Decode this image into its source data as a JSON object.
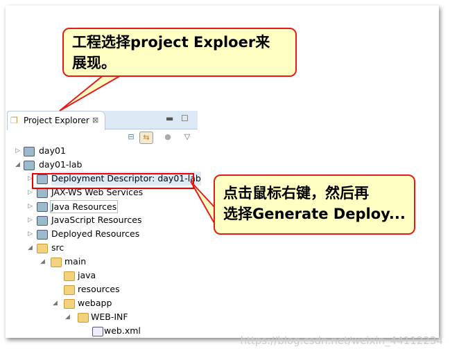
{
  "panel": {
    "tab_label": "Project Explorer",
    "close": "⊠",
    "minimize": "▬",
    "maximize": "☐"
  },
  "toolbar": {
    "collapse": "⊟",
    "link": "⇆",
    "menu": "▽"
  },
  "tree": [
    {
      "label": "day01",
      "expanded": false,
      "icon": "project-icon"
    },
    {
      "label": "day01-lab",
      "expanded": true,
      "icon": "project-icon"
    },
    {
      "label": "Deployment Descriptor: day01-lab",
      "expanded": false,
      "icon": "deployment-descriptor-icon",
      "highlighted": true
    },
    {
      "label": "JAX-WS Web Services",
      "expanded": false,
      "icon": "web-services-icon"
    },
    {
      "label": "Java Resources",
      "expanded": false,
      "icon": "java-resources-icon"
    },
    {
      "label": "JavaScript Resources",
      "expanded": false,
      "icon": "javascript-resources-icon"
    },
    {
      "label": "Deployed Resources",
      "expanded": false,
      "icon": "deployed-resources-icon"
    },
    {
      "label": "src",
      "expanded": true,
      "icon": "folder-icon"
    },
    {
      "label": "main",
      "expanded": true,
      "icon": "folder-icon"
    },
    {
      "label": "java",
      "icon": "folder-icon"
    },
    {
      "label": "resources",
      "icon": "folder-icon"
    },
    {
      "label": "webapp",
      "expanded": true,
      "icon": "folder-icon"
    },
    {
      "label": "WEB-INF",
      "expanded": true,
      "icon": "folder-icon"
    },
    {
      "label": "web.xml",
      "icon": "xml-file-icon"
    }
  ],
  "callouts": {
    "top_line1": "工程选择project Exploer来",
    "top_line2": "展现。",
    "right_line1": "点击鼠标右键，然后再",
    "right_line2": "选择Generate Deploy..."
  },
  "watermark": "https://blog.csdn.net/weixin_44112234",
  "colors": {
    "callout_bg": "#ffffc4",
    "callout_border": "#e21b1b",
    "highlight": "#e00000"
  }
}
